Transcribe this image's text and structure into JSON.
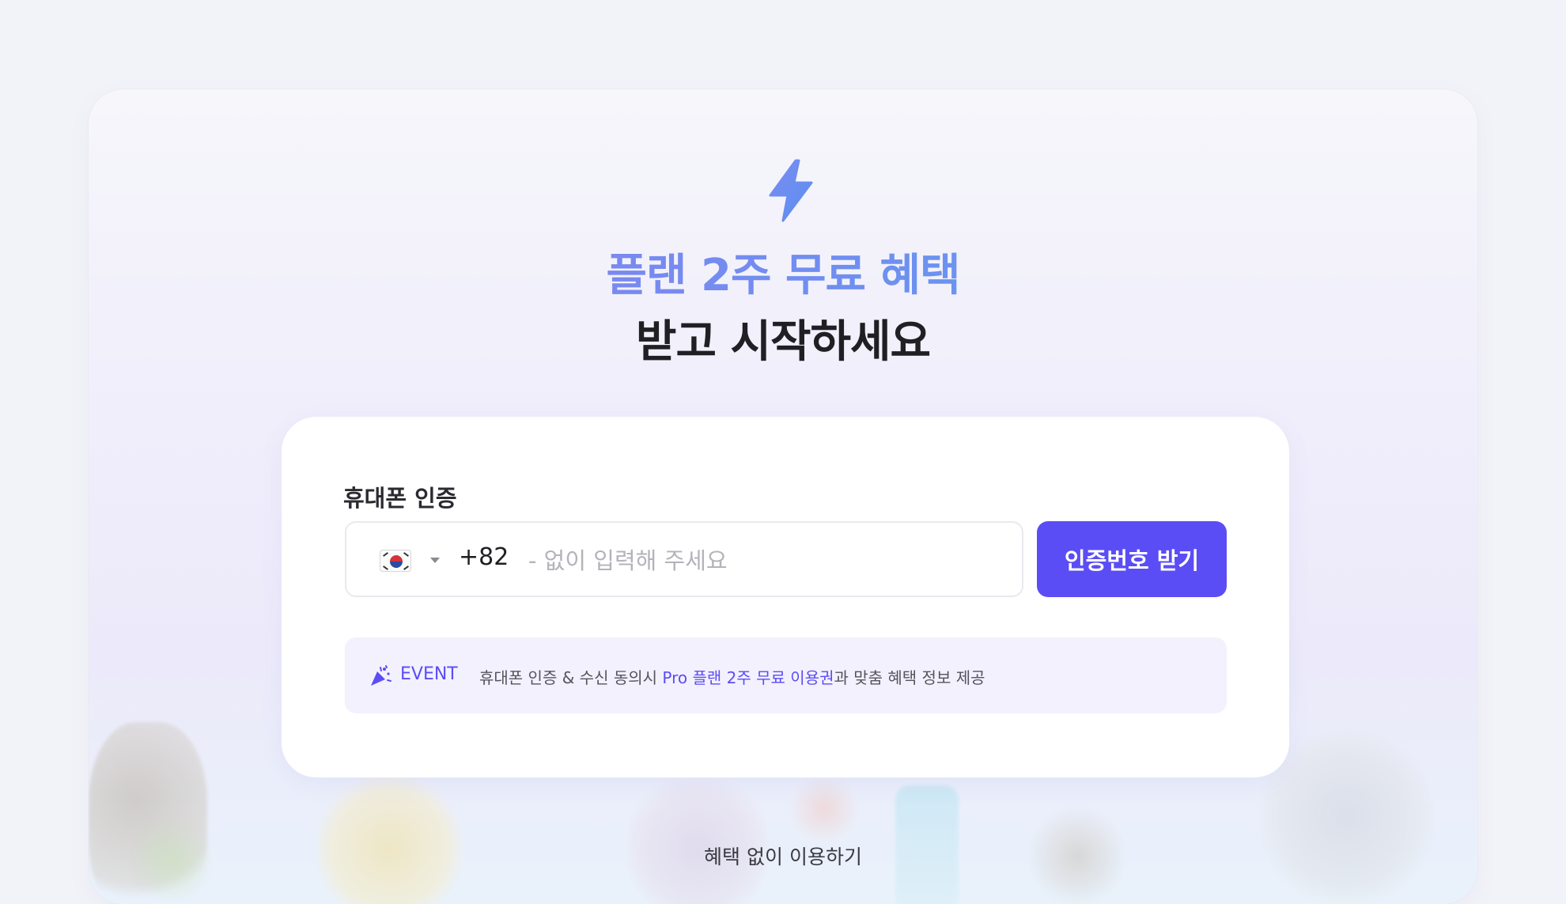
{
  "heading": {
    "line1": "플랜 2주 무료 혜택",
    "line2": "받고 시작하세요"
  },
  "auth": {
    "label": "휴대폰 인증",
    "country_code": "+82",
    "flag_icon": "south-korea-flag-icon",
    "phone_placeholder": "- 없이 입력해 주세요",
    "phone_value": "",
    "send_button": "인증번호 받기"
  },
  "event": {
    "label": "EVENT",
    "text_before": "휴대폰 인증 & 수신 동의시 ",
    "text_highlight": "Pro 플랜 2주 무료 이용권",
    "text_after": "과 맞춤 혜택 정보 제공"
  },
  "skip_link": "혜택 없이 이용하기",
  "colors": {
    "accent": "#5b4df5",
    "gradient_start": "#8f7bf0",
    "gradient_end": "#5aa6ee"
  }
}
